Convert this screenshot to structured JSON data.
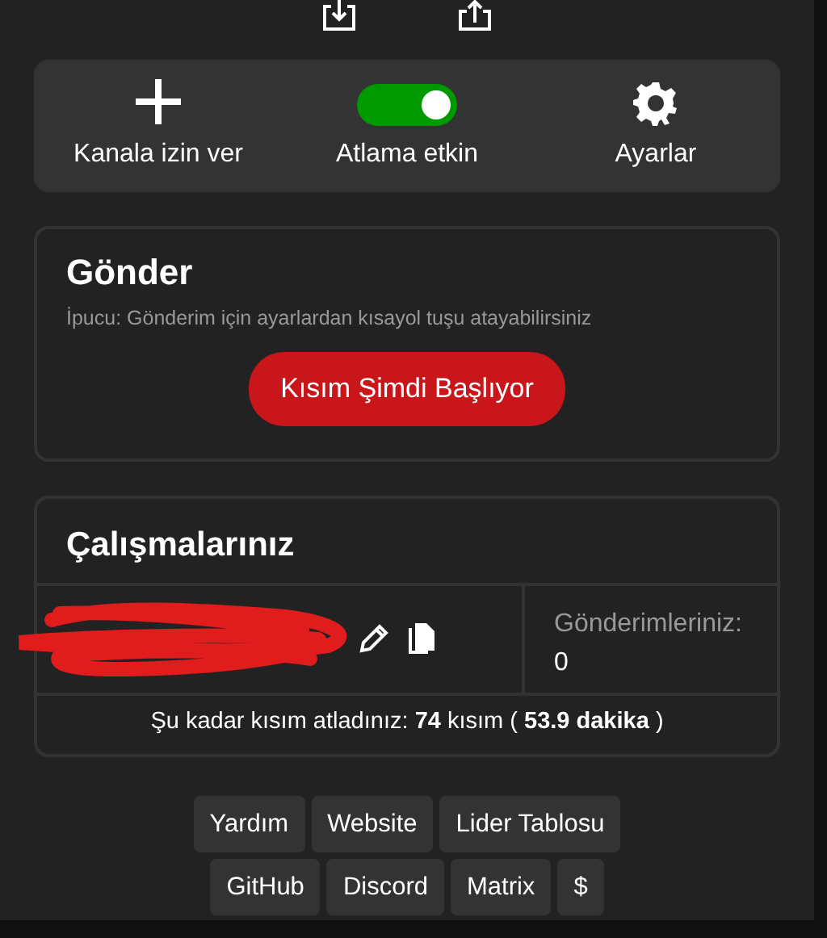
{
  "actions": [
    {
      "kind": "add",
      "label": "Kanala izin ver"
    },
    {
      "kind": "toggle",
      "label": "Atlama etkin",
      "on": true
    },
    {
      "kind": "settings",
      "label": "Ayarlar"
    }
  ],
  "submit": {
    "title": "Gönder",
    "hint": "İpucu: Gönderim için ayarlardan kısayol tuşu atayabilirsiniz",
    "button": "Kısım Şimdi Başlıyor"
  },
  "contributions": {
    "title": "Çalışmalarınız",
    "submissions_label": "Gönderimleriniz:",
    "submissions_value": "0",
    "skipped": "Şu kadar kısım atladınız: **74** kısım ( **53.9 dakika** )"
  },
  "links": [
    [
      "Yardım",
      "Website",
      "Lider Tablosu"
    ],
    [
      "GitHub",
      "Discord",
      "Matrix",
      "$"
    ]
  ]
}
